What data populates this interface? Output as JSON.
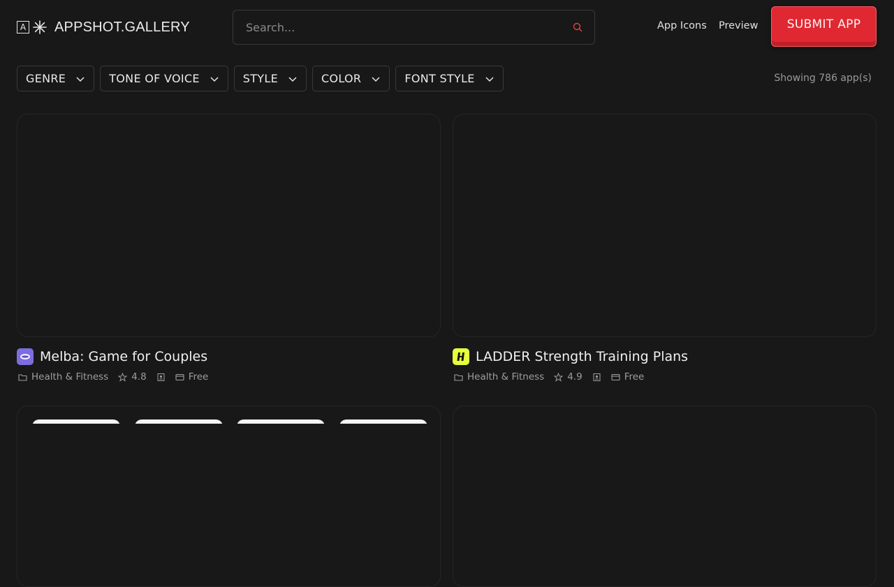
{
  "header": {
    "logo_letter": "A",
    "logo_text": "APPSHOT.GALLERY",
    "search_placeholder": "Search...",
    "nav": [
      "App Icons",
      "Preview"
    ],
    "submit_label": "SUBMIT APP"
  },
  "filters": [
    "GENRE",
    "TONE OF VOICE",
    "STYLE",
    "COLOR",
    "FONT STYLE"
  ],
  "showing": "Showing 786 app(s)",
  "apps": [
    {
      "name": "Melba: Game for Couples",
      "genre": "Health & Fitness",
      "rating": "4.8",
      "price": "Free",
      "icon_color": "#7b6ee0"
    },
    {
      "name": "LADDER Strength Training Plans",
      "genre": "Health & Fitness",
      "rating": "4.9",
      "price": "Free",
      "icon_color": "#e6ff3a"
    }
  ],
  "colors": {
    "accent": "#e02832",
    "background": "#181818"
  }
}
